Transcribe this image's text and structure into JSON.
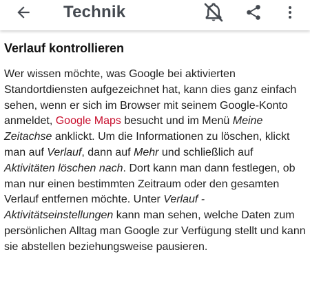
{
  "appbar": {
    "title": "Technik",
    "icons": {
      "back": "arrow-back-icon",
      "notifications": "bell-off-icon",
      "share": "share-icon",
      "more": "more-vertical-icon"
    }
  },
  "article": {
    "heading": "Verlauf kontrollieren",
    "p1_a": "Wer wissen möchte, was Google bei aktivierten Standortdiensten aufgezeichnet hat, kann dies ganz einfach sehen, wenn er sich im Browser mit seinem Google-Konto anmeldet, ",
    "link_google_maps": "Google Maps",
    "p1_b": " besucht und im Menü ",
    "em_meine_zeitachse": "Meine Zeitachse",
    "p1_c": " anklickt. Um die Informationen zu löschen, klickt man auf ",
    "em_verlauf": "Verlauf",
    "p1_d": ", dann auf ",
    "em_mehr": "Mehr",
    "p1_e": " und schließlich auf ",
    "em_aktivitaeten_loeschen": "Aktivitäten löschen nach",
    "p1_f": ". Dort kann man dann festlegen, ob man nur einen bestimmten Zeitraum oder den gesamten Verlauf entfernen möchte. Unter ",
    "em_verlauf_einstellungen": "Verlauf - Aktivitätseinstellungen",
    "p1_g": " kann man sehen, welche Daten zum persönlichen Alltag man Google zur Verfügung stellt und kann sie abstellen beziehungsweise pausieren."
  },
  "colors": {
    "link": "#c8102e",
    "icon": "#444950"
  }
}
